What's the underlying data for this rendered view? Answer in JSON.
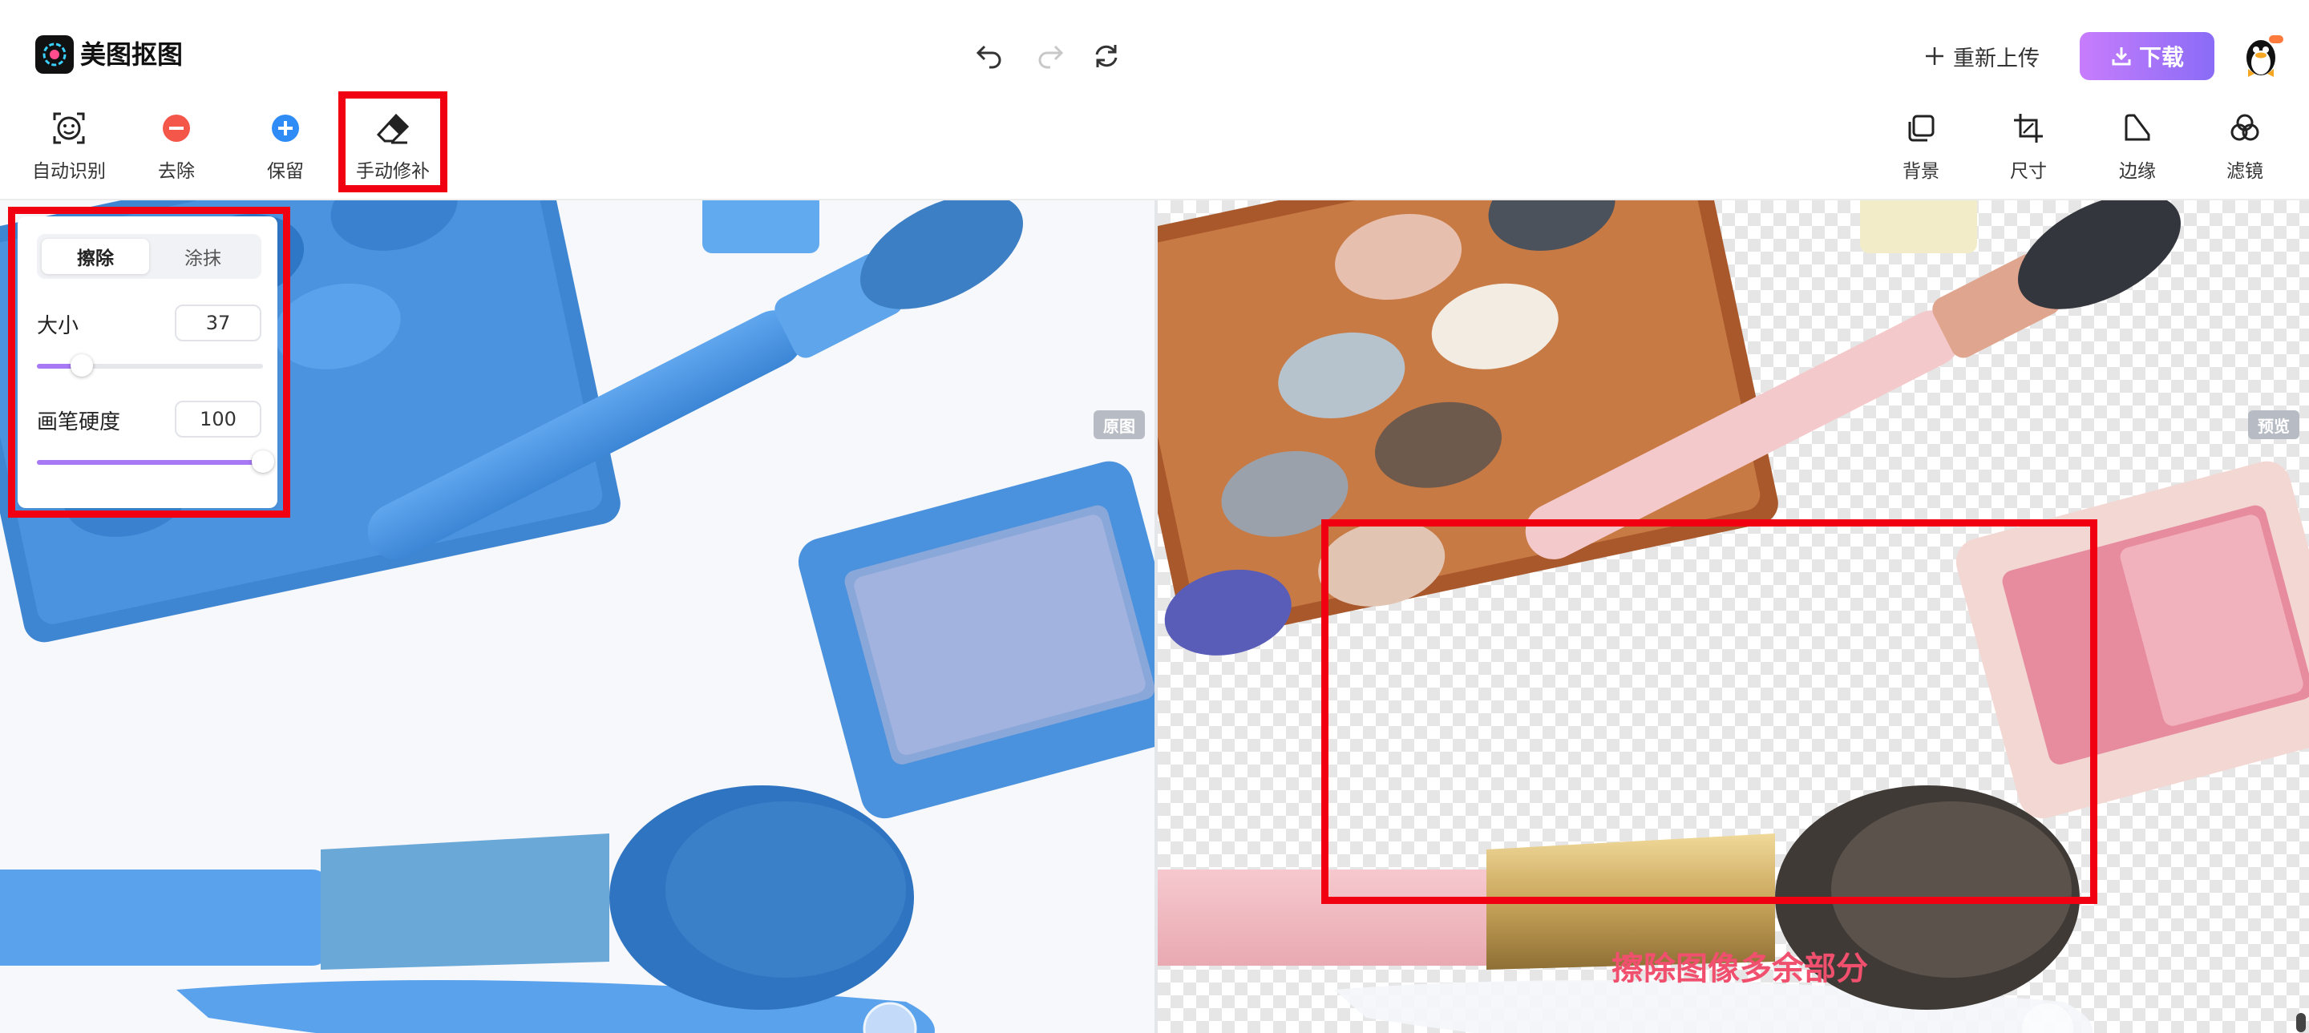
{
  "app": {
    "name": "美图抠图"
  },
  "header": {
    "reupload_label": "重新上传",
    "download_label": "下载"
  },
  "toolbar_left": [
    {
      "label": "自动识别",
      "icon": "smiley-scan-icon"
    },
    {
      "label": "去除",
      "icon": "minus-circle-icon"
    },
    {
      "label": "保留",
      "icon": "plus-circle-icon"
    },
    {
      "label": "手动修补",
      "icon": "eraser-icon"
    }
  ],
  "toolbar_right": [
    {
      "label": "背景",
      "icon": "layers-icon"
    },
    {
      "label": "尺寸",
      "icon": "crop-icon"
    },
    {
      "label": "边缘",
      "icon": "edge-icon"
    },
    {
      "label": "滤镜",
      "icon": "filter-icon"
    }
  ],
  "canvas": {
    "original_tag": "原图",
    "preview_tag": "预览"
  },
  "brush_panel": {
    "mode_active": "擦除",
    "mode_inactive": "涂抹",
    "size_label": "大小",
    "size_value": "37",
    "size_fraction": 0.2,
    "hardness_label": "画笔硬度",
    "hardness_value": "100",
    "hardness_fraction": 1.0
  },
  "annotation": {
    "caption": "擦除图像多余部分"
  },
  "colors": {
    "accent": "#a779f5",
    "highlight": "#f00010",
    "caption": "#f0506e",
    "mask": "#5aa2ec"
  }
}
